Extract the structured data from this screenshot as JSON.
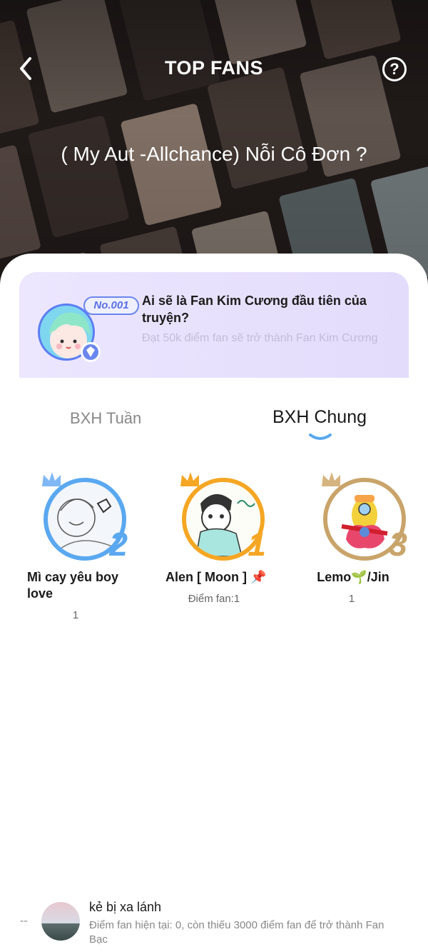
{
  "header": {
    "title": "TOP FANS",
    "story_title": "( My Aut -Allchance) Nỗi Cô Đơn ?",
    "help_symbol": "?"
  },
  "promo": {
    "badge": "No.001",
    "title": "Ai sẽ là Fan Kim Cương đầu tiên của truyện?",
    "subtitle": "Đạt 50k điểm fan sẽ trở thành Fan Kim Cương"
  },
  "tabs": [
    {
      "label": "BXH Tuần",
      "active": false
    },
    {
      "label": "BXH Chung",
      "active": true
    }
  ],
  "podium": [
    {
      "rank": "2",
      "name": "Mì cay yêu boy love",
      "score": "1",
      "ring_color": "#5aa8f0"
    },
    {
      "rank": "1",
      "name": "Alen [ Moon ] 📌",
      "score": "Điểm fan:1",
      "ring_color": "#f5a623"
    },
    {
      "rank": "3",
      "name": "Lemo🌱/Jin",
      "score": "1",
      "ring_color": "#c9a46a"
    }
  ],
  "me": {
    "rank": "--",
    "name": "kẻ bị xa lánh",
    "info": "Điểm fan hiện tại: 0, còn thiếu 3000 điểm fan để trở thành Fan Bạc"
  },
  "colors": {
    "accent": "#5aa8f0",
    "gold": "#f5a623",
    "bronze": "#c9a46a",
    "promo_bg": "#ece6ff"
  }
}
